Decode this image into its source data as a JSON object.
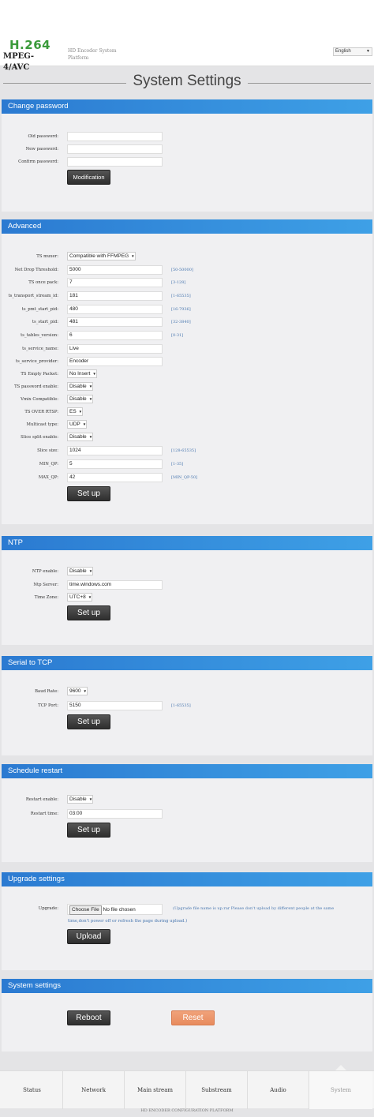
{
  "header": {
    "logo_line1": "H.264",
    "logo_line2": "MPEG-4/AVC",
    "subtitle": "HD Encoder System Platform",
    "language": "English"
  },
  "page_title": "System Settings",
  "change_password": {
    "title": "Change password",
    "old_label": "Old password:",
    "new_label": "New password:",
    "confirm_label": "Confirm password:",
    "button": "Modification"
  },
  "advanced": {
    "title": "Advanced",
    "fields": [
      {
        "label": "TS muxer:",
        "value": "Compatible with FFMPEG",
        "type": "select",
        "hint": ""
      },
      {
        "label": "Net Drop Threshold:",
        "value": "5000",
        "type": "input",
        "hint": "[50-50000]"
      },
      {
        "label": "TS once pack:",
        "value": "7",
        "type": "input",
        "hint": "[3-128]"
      },
      {
        "label": "ts_transport_stream_id:",
        "value": "181",
        "type": "input",
        "hint": "[1-65535]"
      },
      {
        "label": "ts_pmt_start_pid:",
        "value": "480",
        "type": "input",
        "hint": "[16-7936]"
      },
      {
        "label": "ts_start_pid:",
        "value": "481",
        "type": "input",
        "hint": "[32-3840]"
      },
      {
        "label": "ts_tables_version:",
        "value": "6",
        "type": "input",
        "hint": "[0-31]"
      },
      {
        "label": "ts_service_name:",
        "value": "Live",
        "type": "input",
        "hint": ""
      },
      {
        "label": "ts_service_provider:",
        "value": "Encoder",
        "type": "input",
        "hint": ""
      },
      {
        "label": "TS Empty Packet:",
        "value": "No Insert",
        "type": "select",
        "hint": ""
      },
      {
        "label": "TS password enable:",
        "value": "Disable",
        "type": "select",
        "hint": ""
      },
      {
        "label": "Vmix Compatible:",
        "value": "Disable",
        "type": "select",
        "hint": ""
      },
      {
        "label": "TS OVER RTSP:",
        "value": "ES",
        "type": "select",
        "hint": ""
      },
      {
        "label": "Multicast type:",
        "value": "UDP",
        "type": "select",
        "hint": ""
      },
      {
        "label": "Slice split enable:",
        "value": "Disable",
        "type": "select",
        "hint": ""
      },
      {
        "label": "Slice size:",
        "value": "1024",
        "type": "input",
        "hint": "[128-65535]"
      },
      {
        "label": "MIN_QP:",
        "value": "5",
        "type": "input",
        "hint": "[1-35]"
      },
      {
        "label": "MAX_QP:",
        "value": "42",
        "type": "input",
        "hint": "[MIN_QP-50]"
      }
    ],
    "button": "Set up"
  },
  "ntp": {
    "title": "NTP",
    "enable_label": "NTP enable:",
    "enable_value": "Disable",
    "server_label": "Ntp Server:",
    "server_value": "time.windows.com",
    "zone_label": "Time Zone:",
    "zone_value": "UTC+8",
    "button": "Set up"
  },
  "serial": {
    "title": "Serial to TCP",
    "baud_label": "Baud Rate:",
    "baud_value": "9600",
    "port_label": "TCP Port:",
    "port_value": "5150",
    "port_hint": "[1-65535]",
    "button": "Set up"
  },
  "schedule": {
    "title": "Schedule restart",
    "enable_label": "Restart enable:",
    "enable_value": "Disable",
    "time_label": "Restart time:",
    "time_value": "03:00",
    "button": "Set up"
  },
  "upgrade": {
    "title": "Upgrade settings",
    "label": "Upgrade:",
    "file_button": "Choose File",
    "file_status": "No file chosen",
    "note_line1": "(Upgrade file name is up.rar Please don't upload by different people at the same",
    "note_line2": "time,don't power off or refresh the page during upload.)",
    "button": "Upload"
  },
  "system": {
    "title": "System settings",
    "reboot": "Reboot",
    "reset": "Reset"
  },
  "nav": [
    "Status",
    "Network",
    "Main stream",
    "Substream",
    "Audio",
    "System"
  ],
  "footer": "HD ENCODER CONFIGURATION PLATFORM"
}
